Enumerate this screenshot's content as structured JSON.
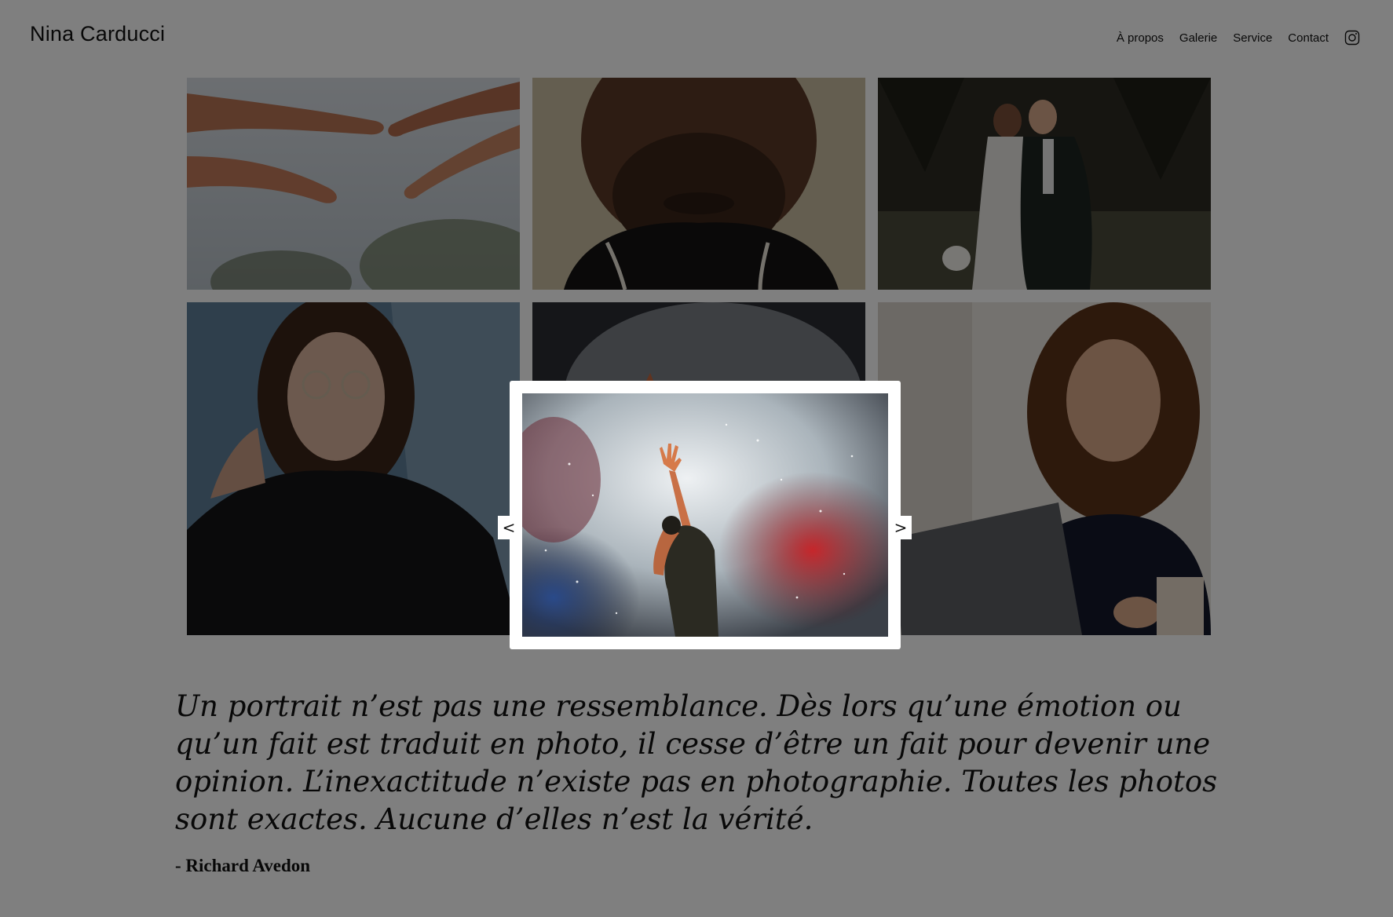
{
  "header": {
    "brand": "Nina Carducci",
    "nav": [
      {
        "label": "À propos"
      },
      {
        "label": "Galerie"
      },
      {
        "label": "Service"
      },
      {
        "label": "Contact"
      }
    ],
    "instagram_icon": "instagram-icon"
  },
  "gallery": {
    "tiles": [
      {
        "subject": "hands-reaching"
      },
      {
        "subject": "man-portrait"
      },
      {
        "subject": "wedding-couple"
      },
      {
        "subject": "woman-glasses"
      },
      {
        "subject": "concert-singer"
      },
      {
        "subject": "woman-laughing-laptop"
      }
    ]
  },
  "quote": {
    "text": "Un portrait n’est pas une ressemblance. Dès lors qu’une émotion ou qu’un fait est traduit en photo, il cesse d’être un fait pour devenir une opinion. L’inexactitude n’existe pas en photographie. Toutes les photos sont exactes. Aucune d’elles n’est la vérité.",
    "author": "- Richard Avedon"
  },
  "lightbox": {
    "prev_label": "<",
    "next_label": ">",
    "image_subject": "concert-singer"
  },
  "colors": {
    "overlay": "#000000",
    "modal_bg": "#ffffff"
  }
}
